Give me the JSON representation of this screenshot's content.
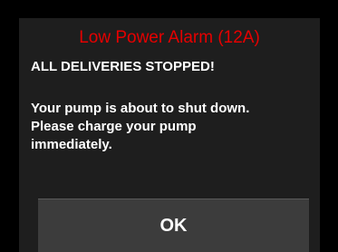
{
  "alarm": {
    "title": "Low Power Alarm (12A)",
    "subtitle": "ALL DELIVERIES STOPPED!",
    "message_lines": [
      "Your pump is about to shut down.",
      "Please charge your pump",
      "immediately."
    ],
    "ok_label": "OK"
  },
  "colors": {
    "title": "#e50000",
    "text": "#ffffff",
    "screen_background": "#000000",
    "panel_background": "#1e1e1e",
    "button_background": "#3c3c3c"
  }
}
